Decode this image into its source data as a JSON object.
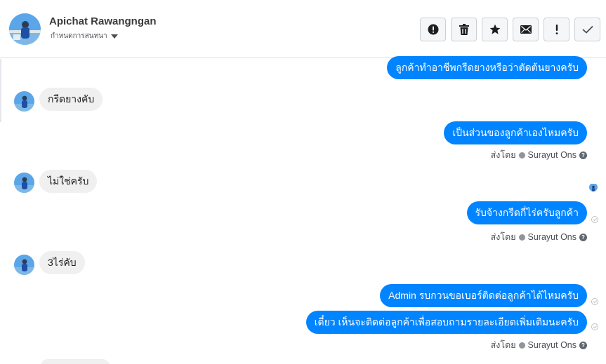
{
  "header": {
    "contact_name": "Apichat Rawangngan",
    "assign_label": "กำหนดการสนทนา",
    "avatar_icon": "profile-photo",
    "actions": [
      {
        "name": "mark-spam-button",
        "icon": "alert-circle-icon"
      },
      {
        "name": "delete-button",
        "icon": "trash-icon"
      },
      {
        "name": "star-button",
        "icon": "star-icon"
      },
      {
        "name": "mark-unread-button",
        "icon": "envelope-icon"
      },
      {
        "name": "follow-up-button",
        "icon": "exclamation-icon"
      },
      {
        "name": "mark-done-button",
        "icon": "checkmark-icon"
      }
    ]
  },
  "messages": [
    {
      "direction": "out",
      "text": "ลูกค้าทำอาชีพกรีดยางหรือว่าตัดต้นยางครับ"
    },
    {
      "direction": "in",
      "text": "กรีดยางคับ"
    },
    {
      "direction": "out",
      "text": "เป็นส่วนของลูกค้าเองไหมครับ"
    },
    {
      "direction": "in",
      "text": "ไม่ใช่ครับ"
    },
    {
      "direction": "out",
      "text": "รับจ้างกรีดกี่ไร่ครับลูกค้า"
    },
    {
      "direction": "in",
      "text": "3ไร่คับ"
    },
    {
      "direction": "out",
      "text": "Admin รบกวนขอเบอร์ติดต่อลูกค้าได้ไหมครับ"
    },
    {
      "direction": "out",
      "text": "เดี๋ยว เห็นจะติดต่อลูกค้าเพื่อสอบถามรายละเอียดเพิ่มเติมนะครับ"
    }
  ],
  "sent_by": {
    "prefix": "ส่งโดย",
    "agent": "Surayut Ons",
    "help": "?"
  },
  "colors": {
    "outgoing_bubble": "#0084ff",
    "incoming_bubble": "#f0f0f0"
  }
}
